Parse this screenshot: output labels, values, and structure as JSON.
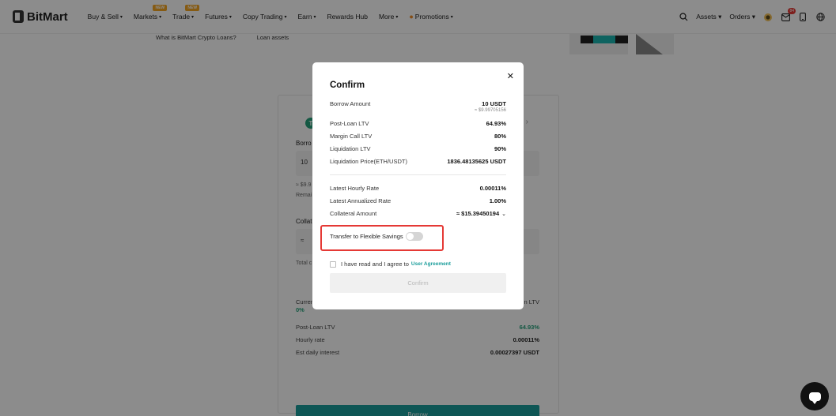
{
  "header": {
    "brand": "BitMart",
    "nav": [
      {
        "label": "Buy & Sell",
        "caret": true,
        "badge": ""
      },
      {
        "label": "Markets",
        "caret": true,
        "badge": "NEW"
      },
      {
        "label": "Trade",
        "caret": true,
        "badge": "NEW"
      },
      {
        "label": "Futures",
        "caret": true,
        "badge": ""
      },
      {
        "label": "Copy Trading",
        "caret": true,
        "badge": ""
      },
      {
        "label": "Earn",
        "caret": true,
        "badge": ""
      },
      {
        "label": "Rewards Hub",
        "caret": false,
        "badge": ""
      },
      {
        "label": "More",
        "caret": true,
        "badge": ""
      },
      {
        "label": "Promotions",
        "caret": true,
        "badge": ""
      }
    ],
    "right": {
      "assets": "Assets",
      "orders": "Orders",
      "notification_count": "84"
    }
  },
  "page": {
    "breadcrumb_1": "What is BitMart Crypto Loans?",
    "breadcrumb_2": "Loan assets",
    "coin_symbol": "T",
    "borrow_label": "Borro",
    "borrow_input": "10",
    "approx": "≈ $9.9",
    "remain": "Remai",
    "collateral_label": "Collat",
    "collateral_input": "≈",
    "total": "Total c",
    "current_label": "Curren",
    "current_value": "0%",
    "ltv_label": "n LTV",
    "post_loan_ltv_label": "Post-Loan LTV",
    "post_loan_ltv_value": "64.93%",
    "hourly_rate_label": "Hourly rate",
    "hourly_rate_value": "0.00011%",
    "daily_interest_label": "Est daily interest",
    "daily_interest_value": "0.00027397 USDT",
    "borrow_button": "Borrow"
  },
  "modal": {
    "title": "Confirm",
    "borrow_amount_label": "Borrow Amount",
    "borrow_amount_value": "10 USDT",
    "borrow_amount_sub": "≈ $9.99705156",
    "post_loan_ltv_label": "Post-Loan LTV",
    "post_loan_ltv_value": "64.93%",
    "margin_call_label": "Margin Call LTV",
    "margin_call_value": "80%",
    "liquidation_ltv_label": "Liquidation LTV",
    "liquidation_ltv_value": "90%",
    "liquidation_price_label": "Liquidation Price(ETH/USDT)",
    "liquidation_price_value": "1836.48135625 USDT",
    "hourly_rate_label": "Latest Hourly Rate",
    "hourly_rate_value": "0.00011%",
    "annualized_rate_label": "Latest Annualized Rate",
    "annualized_rate_value": "1.00%",
    "collateral_label": "Collateral Amount",
    "collateral_value": "≈ $15.39450194",
    "transfer_label": "Transfer to Flexible Savings",
    "transfer_enabled": false,
    "agree_text": "I have read and I agree to",
    "agree_link": "User Agreement",
    "confirm_button": "Confirm"
  },
  "colors": {
    "accent": "#1a9d9b",
    "positive": "#26a17b",
    "highlight_border": "#e53935"
  }
}
